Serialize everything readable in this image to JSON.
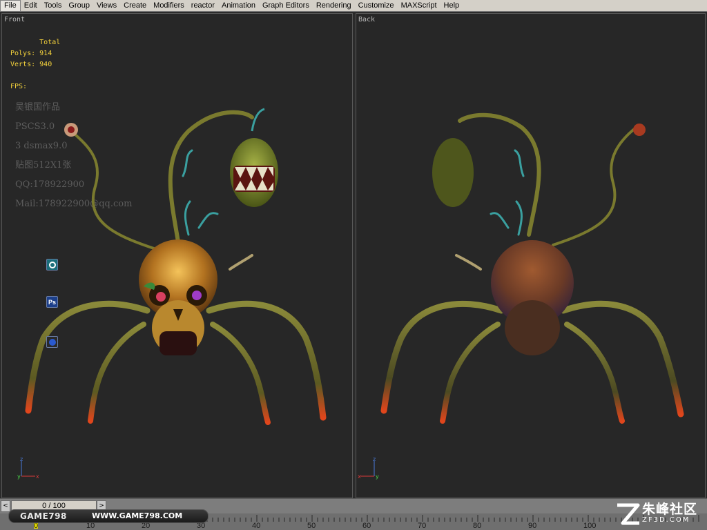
{
  "menu": {
    "items": [
      "File",
      "Edit",
      "Tools",
      "Group",
      "Views",
      "Create",
      "Modifiers",
      "reactor",
      "Animation",
      "Graph Editors",
      "Rendering",
      "Customize",
      "MAXScript",
      "Help"
    ]
  },
  "viewports": {
    "front": {
      "label": "Front",
      "stats": {
        "total_label": "Total",
        "polys_label": "Polys:",
        "polys_value": "914",
        "verts_label": "Verts:",
        "verts_value": "940",
        "fps_label": "FPS:"
      },
      "watermark_lines": [
        "吴银国作品",
        "PSCS3.0",
        "3 dsmax9.0",
        "贴图512X1张",
        "QQ:178922900",
        "Mail:178922900@qq.com"
      ]
    },
    "back": {
      "label": "Back"
    }
  },
  "timeline": {
    "frame_counter": "0 / 100",
    "prev_symbol": "<",
    "next_symbol": ">",
    "ticks": [
      "0",
      "10",
      "20",
      "30",
      "40",
      "50",
      "60",
      "70",
      "80",
      "90",
      "100"
    ]
  },
  "branding": {
    "game_name": "GAME798",
    "game_url": "WWW.GAME798.COM",
    "site_name": "朱峰社区",
    "site_url": "ZF3D.COM"
  },
  "colors": {
    "stats_text": "#f4d23c",
    "viewport_bg": "#272727",
    "menu_bg": "#d4d0c8"
  }
}
